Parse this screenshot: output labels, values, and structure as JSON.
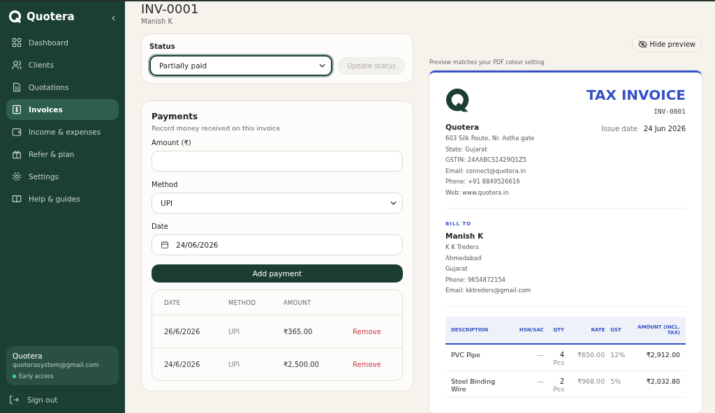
{
  "sidebar": {
    "brand": "Quotera",
    "collapse": "‹",
    "items": [
      {
        "label": "Dashboard",
        "selected": false
      },
      {
        "label": "Clients",
        "selected": false
      },
      {
        "label": "Quotations",
        "selected": false
      },
      {
        "label": "Invoices",
        "selected": true
      },
      {
        "label": "Income & expenses",
        "selected": false
      },
      {
        "label": "Refer & plan",
        "selected": false
      },
      {
        "label": "Settings",
        "selected": false
      },
      {
        "label": "Help & guides",
        "selected": false
      }
    ],
    "account": {
      "name": "Quotera",
      "email": "quoterasystem@gmail.com",
      "plan": "Early access"
    },
    "sign_out": "Sign out"
  },
  "header": {
    "title": "INV-0001",
    "client": "Manish K"
  },
  "status": {
    "label": "Status",
    "value": "Partially paid",
    "button": "Update status",
    "button_disabled": true
  },
  "payments": {
    "title": "Payments",
    "subtitle": "Record money received on this invoice",
    "amount_label": "Amount (₹)",
    "method_label": "Method",
    "method_value": "UPI",
    "date_label": "Date",
    "date_value": "24/06/2026",
    "button": "Add payment",
    "columns": [
      "DATE",
      "METHOD",
      "AMOUNT"
    ],
    "rows": [
      {
        "date": "26/6/2026",
        "method": "UPI",
        "amount": "₹365.00",
        "action": "Remove"
      },
      {
        "date": "24/6/2026",
        "method": "UPI",
        "amount": "₹2,500.00",
        "action": "Remove"
      }
    ]
  },
  "preview": {
    "hide_button": "Hide preview",
    "note": "Preview matches your PDF colour setting",
    "doc_title": "TAX INVOICE",
    "number": "INV-0001",
    "issue_label": "Issue date",
    "issue_date": "24 Jun 2026",
    "company": "Quotera",
    "company_lines": [
      "603 Silk Route, Nr. Astha gate",
      "State: Gujarat",
      "GSTIN: 24AABCS1429Q1Z5",
      "Email: connect@quotera.in",
      "Phone: +91 8849526616",
      "Web: www.quotera.in"
    ],
    "bill_to_label": "BILL TO",
    "bill_to_name": "Manish K",
    "bill_to_lines": [
      "K K Treders",
      "Ahmedabad",
      "Gujarat",
      "Phone: 9654872154",
      "Email: kktreders@gmail.com"
    ],
    "columns": [
      "DESCRIPTION",
      "HSN/SAC",
      "QTY",
      "RATE",
      "GST",
      "AMOUNT (INCL. TAX)"
    ],
    "rows": [
      {
        "description": "PVC Pipe",
        "hsn": "—",
        "qty": "4",
        "unit": "Pcs",
        "rate": "₹650.00",
        "gst": "12%",
        "amount": "₹2,912.00"
      },
      {
        "description": "Steel Binding Wire",
        "hsn": "—",
        "qty": "2",
        "unit": "Pcs",
        "rate": "₹968.00",
        "gst": "5%",
        "amount": "₹2,032.80"
      }
    ]
  }
}
